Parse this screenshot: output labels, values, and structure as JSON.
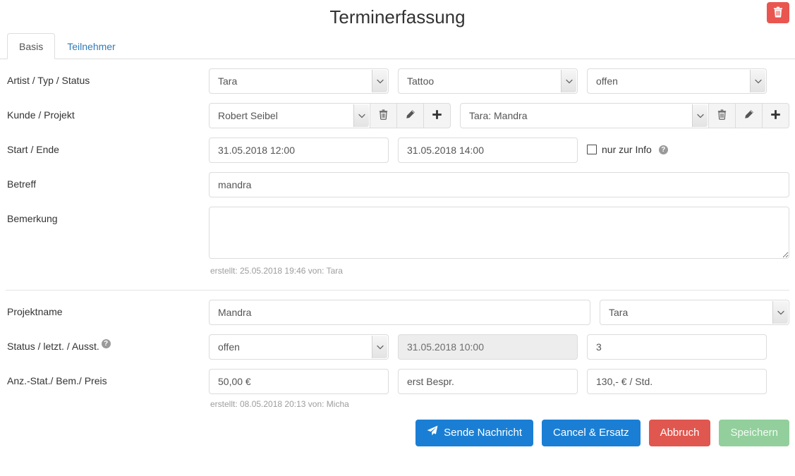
{
  "header": {
    "title": "Terminerfassung",
    "delete_icon": "trash-icon"
  },
  "tabs": [
    {
      "label": "Basis",
      "active": true
    },
    {
      "label": "Teilnehmer",
      "active": false
    }
  ],
  "form": {
    "row_artist": {
      "label": "Artist / Typ / Status",
      "artist": "Tara",
      "typ": "Tattoo",
      "status": "offen"
    },
    "row_kunde": {
      "label": "Kunde / Projekt",
      "kunde": "Robert Seibel",
      "projekt": "Tara: Mandra",
      "buttons": [
        "trash-icon",
        "pencil-icon",
        "plus-icon"
      ]
    },
    "row_start": {
      "label": "Start / Ende",
      "start": "31.05.2018 12:00",
      "ende": "31.05.2018 14:00",
      "info_checkbox_label": "nur zur Info",
      "info_checkbox_checked": false,
      "help_icon": "question-circle-icon"
    },
    "row_betreff": {
      "label": "Betreff",
      "value": "mandra"
    },
    "row_bemerkung": {
      "label": "Bemerkung",
      "value": "",
      "helper": "erstellt: 25.05.2018 19:46 von: Tara"
    },
    "row_projektname": {
      "label": "Projektname",
      "name": "Mandra",
      "owner": "Tara"
    },
    "row_status": {
      "label": "Status / letzt. / Ausst.",
      "help_icon": "question-circle-icon",
      "status": "offen",
      "letzte": "31.05.2018 10:00",
      "letzte_disabled": true,
      "ausstehend": "3"
    },
    "row_anz": {
      "label": "Anz.-Stat./ Bem./ Preis",
      "anzahlung": "50,00 €",
      "bemerkung": "erst Bespr.",
      "preis": "130,- € / Std.",
      "helper": "erstellt: 08.05.2018 20:13 von: Micha"
    }
  },
  "footer": {
    "send_label": "Sende Nachricht",
    "send_icon": "paper-plane-icon",
    "cancel_replace_label": "Cancel & Ersatz",
    "abort_label": "Abbruch",
    "save_label": "Speichern"
  },
  "colors": {
    "primary": "#1a7fd4",
    "danger": "#e0574f",
    "delete": "#e9564f",
    "success_muted": "#92cf9c",
    "link": "#337ab7"
  }
}
